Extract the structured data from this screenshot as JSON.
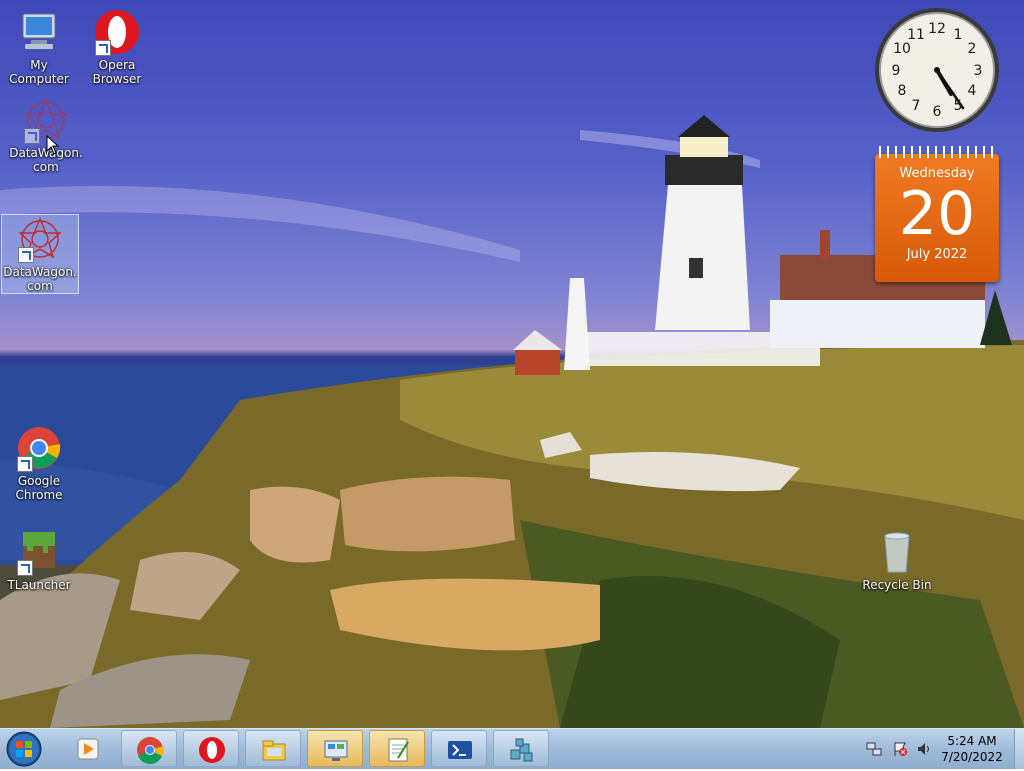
{
  "desktop_icons": [
    {
      "label": "My Computer"
    },
    {
      "label": "Opera Browser"
    },
    {
      "label": "DataWagon.com"
    },
    {
      "label": "DataWagon.com"
    },
    {
      "label": "Google Chrome"
    },
    {
      "label": "TLauncher"
    },
    {
      "label": "Recycle Bin"
    }
  ],
  "gadgets": {
    "clock": {
      "numbers": [
        "12",
        "1",
        "2",
        "3",
        "4",
        "5",
        "6",
        "7",
        "8",
        "9",
        "10",
        "11"
      ],
      "time": "5:24"
    },
    "calendar": {
      "weekday": "Wednesday",
      "day": "20",
      "month_year": "July 2022"
    }
  },
  "taskbar": {
    "buttons": [
      {
        "name": "media-player"
      },
      {
        "name": "google-chrome"
      },
      {
        "name": "opera"
      },
      {
        "name": "file-explorer"
      },
      {
        "name": "control-panel"
      },
      {
        "name": "notepad-editor"
      },
      {
        "name": "powershell"
      },
      {
        "name": "package-tool"
      }
    ],
    "tray": {
      "time": "5:24 AM",
      "date": "7/20/2022"
    }
  },
  "colors": {
    "calendar_accent": "#e8681a",
    "taskbar": "#a9c2de"
  }
}
